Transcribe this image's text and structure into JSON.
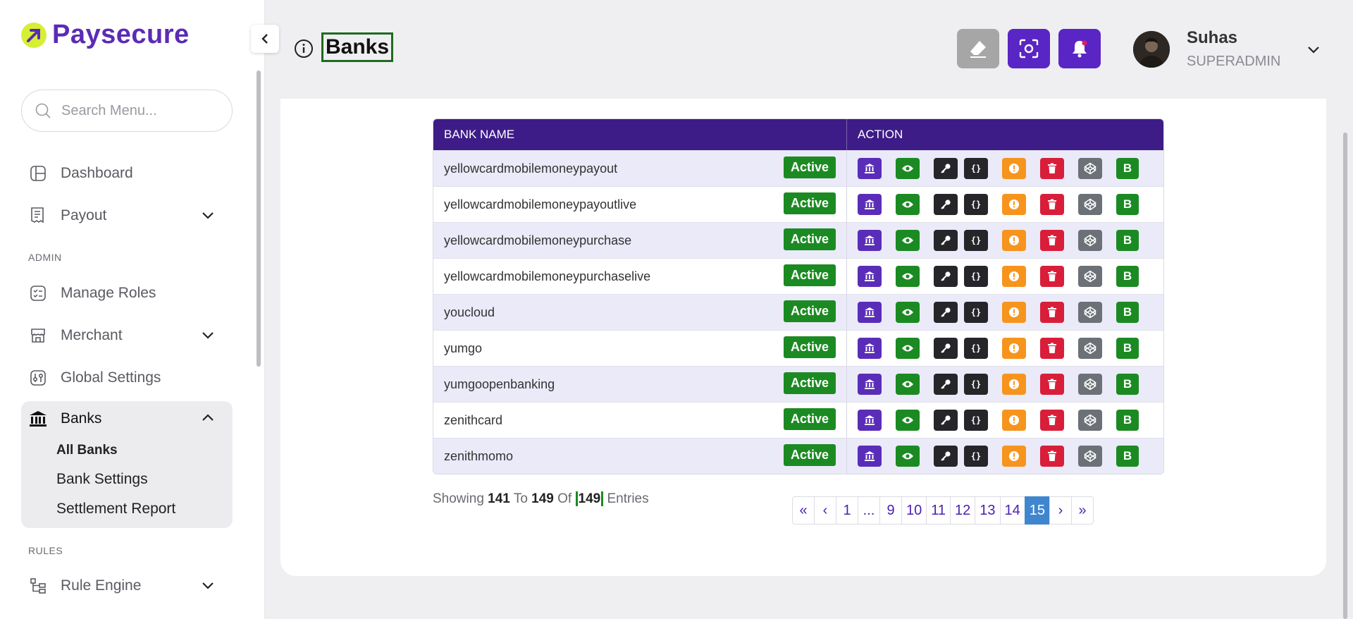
{
  "brand": {
    "name": "Paysecure",
    "accent": "#5b2bb5",
    "logo_color": "#d6ef34"
  },
  "sidebar": {
    "search_placeholder": "Search Menu...",
    "items": {
      "dashboard": "Dashboard",
      "payout": "Payout",
      "admin_label": "ADMIN",
      "manage_roles": "Manage Roles",
      "merchant": "Merchant",
      "global_settings": "Global Settings",
      "banks": "Banks",
      "rules_label": "RULES",
      "rule_engine": "Rule Engine"
    },
    "banks_sub": {
      "all_banks": "All Banks",
      "bank_settings": "Bank Settings",
      "settlement_report": "Settlement Report"
    }
  },
  "header": {
    "title": "Banks",
    "user": {
      "name": "Suhas",
      "role": "SUPERADMIN"
    }
  },
  "table": {
    "headers": {
      "bank_name": "BANK NAME",
      "action": "ACTION"
    },
    "rows": [
      {
        "name": "yellowcardmobilemoneypayout",
        "status": "Active"
      },
      {
        "name": "yellowcardmobilemoneypayoutlive",
        "status": "Active"
      },
      {
        "name": "yellowcardmobilemoneypurchase",
        "status": "Active"
      },
      {
        "name": "yellowcardmobilemoneypurchaselive",
        "status": "Active"
      },
      {
        "name": "youcloud",
        "status": "Active"
      },
      {
        "name": "yumgo",
        "status": "Active"
      },
      {
        "name": "yumgoopenbanking",
        "status": "Active"
      },
      {
        "name": "zenithcard",
        "status": "Active"
      },
      {
        "name": "zenithmomo",
        "status": "Active"
      }
    ],
    "action_buttons": [
      {
        "name": "bank-icon",
        "color": "#5a2db8"
      },
      {
        "name": "eye-icon",
        "color": "#1c8a22"
      },
      {
        "name": "key-icon",
        "color": "#25252a"
      },
      {
        "name": "code-icon",
        "color": "#25252a",
        "text": "{}"
      },
      {
        "name": "alert-icon",
        "color": "#f7941d"
      },
      {
        "name": "trash-icon",
        "color": "#d91e3a"
      },
      {
        "name": "codepen-icon",
        "color": "#6c7177"
      },
      {
        "name": "b-letter-icon",
        "color": "#1c8a22",
        "text": "B"
      }
    ]
  },
  "pagination": {
    "showing_label": "Showing",
    "from": "141",
    "to_label": "To",
    "to": "149",
    "of_label": "Of",
    "total": "149",
    "entries_label": "Entries",
    "pages": [
      "«",
      "‹",
      "1",
      "...",
      "9",
      "10",
      "11",
      "12",
      "13",
      "14",
      "15",
      "›",
      "»"
    ],
    "active_page": "15"
  }
}
